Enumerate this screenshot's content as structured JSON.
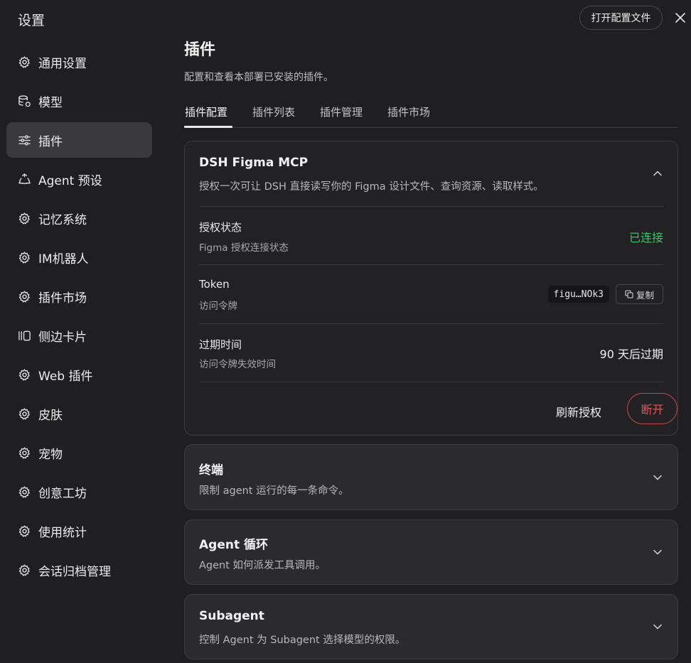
{
  "app_title": "设置",
  "sidebar": {
    "items": [
      {
        "label": "通用设置",
        "icon": "gear-icon"
      },
      {
        "label": "模型",
        "icon": "database-gear-icon"
      },
      {
        "label": "插件",
        "icon": "sliders-icon",
        "active": true
      },
      {
        "label": "Agent 预设",
        "icon": "recycle-icon"
      },
      {
        "label": "记忆系统",
        "icon": "gear-icon"
      },
      {
        "label": "IM机器人",
        "icon": "gear-icon"
      },
      {
        "label": "插件市场",
        "icon": "gear-icon"
      },
      {
        "label": "侧边卡片",
        "icon": "side-panel-icon"
      },
      {
        "label": "Web 插件",
        "icon": "gear-icon"
      },
      {
        "label": "皮肤",
        "icon": "gear-icon"
      },
      {
        "label": "宠物",
        "icon": "gear-icon"
      },
      {
        "label": "创意工坊",
        "icon": "gear-icon"
      },
      {
        "label": "使用统计",
        "icon": "gear-icon"
      },
      {
        "label": "会话归档管理",
        "icon": "gear-icon"
      }
    ]
  },
  "header": {
    "open_config_label": "打开配置文件",
    "close_icon": "close-icon"
  },
  "main": {
    "title": "插件",
    "description": "配置和查看本部署已安装的插件。",
    "tabs": [
      {
        "label": "插件配置",
        "active": true
      },
      {
        "label": "插件列表"
      },
      {
        "label": "插件管理"
      },
      {
        "label": "插件市场"
      }
    ],
    "cards": [
      {
        "title": "DSH Figma MCP",
        "description": "授权一次可让 DSH 直接读写你的 Figma 设计文件、查询资源、读取样式。",
        "expanded": true,
        "rows": {
          "auth": {
            "label": "授权状态",
            "sub": "Figma 授权连接状态",
            "value": "已连接"
          },
          "token": {
            "label": "Token",
            "sub": "访问令牌",
            "value": "figu…NOk3",
            "copy_label": "复制"
          },
          "expiry": {
            "label": "过期时间",
            "sub": "访问令牌失效时间",
            "value": "90 天后过期"
          }
        },
        "refresh_label": "刷新授权",
        "disconnect_label": "断开"
      },
      {
        "title": "终端",
        "description": "限制 agent 运行的每一条命令。",
        "expanded": false
      },
      {
        "title": "Agent 循环",
        "description": "Agent 如何派发工具调用。",
        "expanded": false
      },
      {
        "title": "Subagent",
        "description": "控制 Agent 为 Subagent 选择模型的权限。",
        "expanded": false
      }
    ]
  },
  "colors": {
    "background": "#1f1f21",
    "active_nav": "#3a3a3d",
    "connected": "#3fbf6a",
    "danger": "#e05858"
  }
}
